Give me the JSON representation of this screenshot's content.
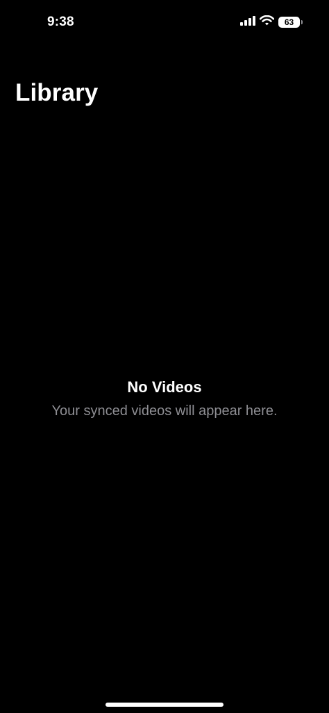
{
  "status_bar": {
    "time": "9:38",
    "battery_level": "63",
    "icons": [
      "cellular-signal-icon",
      "wifi-icon",
      "battery-icon"
    ]
  },
  "header": {
    "title": "Library"
  },
  "empty_state": {
    "title": "No Videos",
    "subtitle": "Your synced videos will appear here."
  },
  "colors": {
    "background": "#000000",
    "primary_text": "#ffffff",
    "secondary_text": "#8e8e93"
  }
}
